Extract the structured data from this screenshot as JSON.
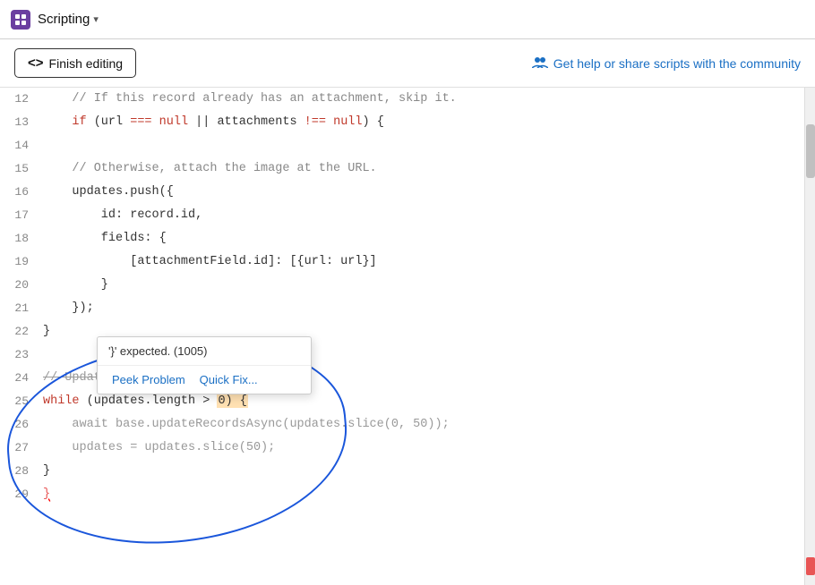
{
  "titleBar": {
    "appName": "Scripting",
    "dropdownLabel": "▾"
  },
  "toolbar": {
    "finishEditingLabel": "Finish editing",
    "codeIcon": "<>",
    "communityLabel": "Get help or share scripts with the community",
    "communityIcon": "👥"
  },
  "editor": {
    "lines": [
      {
        "num": 12,
        "content": "    // If this record already has an attachment, skip it.",
        "type": "comment"
      },
      {
        "num": 13,
        "content": "    if (url === null || attachments !== null) {",
        "type": "code"
      },
      {
        "num": 14,
        "content": "",
        "type": "blank"
      },
      {
        "num": 15,
        "content": "    // Otherwise, attach the image at the URL.",
        "type": "comment"
      },
      {
        "num": 16,
        "content": "    updates.push({",
        "type": "code"
      },
      {
        "num": 17,
        "content": "        id: record.id,",
        "type": "code"
      },
      {
        "num": 18,
        "content": "        fields: {",
        "type": "code"
      },
      {
        "num": 19,
        "content": "            [attachmentField.id]: [{url: url}]",
        "type": "code"
      },
      {
        "num": 20,
        "content": "        }",
        "type": "code"
      },
      {
        "num": 21,
        "content": "    });",
        "type": "code"
      },
      {
        "num": 22,
        "content": "}",
        "type": "code"
      },
      {
        "num": 23,
        "content": "",
        "type": "blank"
      },
      {
        "num": 24,
        "content": "// Update records in batches of 50.",
        "type": "comment_strike"
      },
      {
        "num": 25,
        "content": "while (updates.length > 0) {",
        "type": "code_highlight"
      },
      {
        "num": 26,
        "content": "    await base.updateRecordsAsync(updates.slice(0, 50));",
        "type": "code"
      },
      {
        "num": 27,
        "content": "    updates = updates.slice(50);",
        "type": "code"
      },
      {
        "num": 28,
        "content": "}",
        "type": "code"
      },
      {
        "num": 29,
        "content": "}",
        "type": "error"
      }
    ]
  },
  "errorPopup": {
    "message": "'}' expected. (1005)",
    "actions": [
      "Peek Problem",
      "Quick Fix..."
    ]
  }
}
